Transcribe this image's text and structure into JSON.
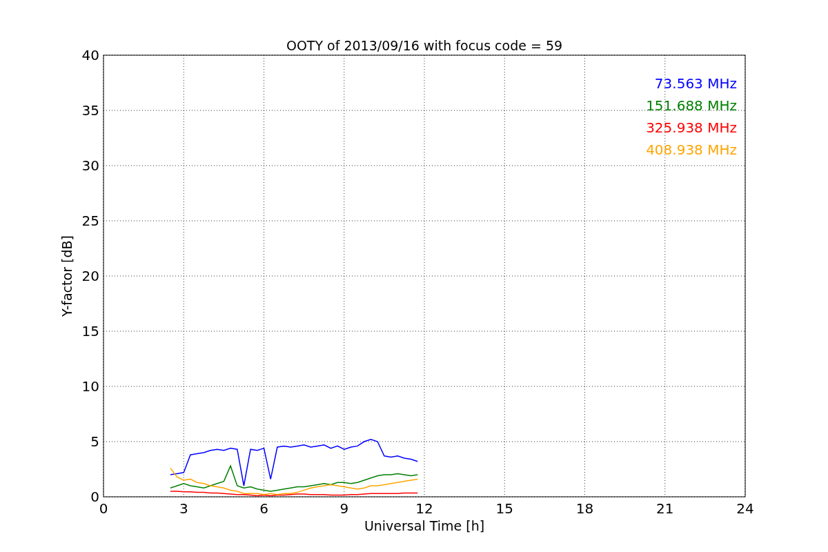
{
  "chart_data": {
    "type": "line",
    "title": "OOTY of 2013/09/16 with focus code = 59",
    "xlabel": "Universal Time [h]",
    "ylabel": "Y-factor [dB]",
    "xlim": [
      0,
      24
    ],
    "ylim": [
      0,
      40
    ],
    "xticks": [
      0,
      3,
      6,
      9,
      12,
      15,
      18,
      21,
      24
    ],
    "yticks": [
      0,
      5,
      10,
      15,
      20,
      25,
      30,
      35,
      40
    ],
    "grid": true,
    "x": [
      2.5,
      2.75,
      3.0,
      3.25,
      3.5,
      3.75,
      4.0,
      4.25,
      4.5,
      4.75,
      5.0,
      5.25,
      5.5,
      5.75,
      6.0,
      6.25,
      6.5,
      6.75,
      7.0,
      7.25,
      7.5,
      7.75,
      8.0,
      8.25,
      8.5,
      8.75,
      9.0,
      9.25,
      9.5,
      9.75,
      10.0,
      10.25,
      10.5,
      10.75,
      11.0,
      11.25,
      11.5,
      11.75
    ],
    "series": [
      {
        "name": "73.563 MHz",
        "color": "#0000ff",
        "values": [
          2.0,
          2.1,
          2.2,
          3.8,
          3.9,
          4.0,
          4.2,
          4.3,
          4.2,
          4.4,
          4.3,
          1.0,
          4.3,
          4.2,
          4.4,
          1.6,
          4.5,
          4.6,
          4.5,
          4.6,
          4.7,
          4.5,
          4.6,
          4.7,
          4.4,
          4.6,
          4.3,
          4.5,
          4.6,
          5.0,
          5.2,
          5.0,
          3.7,
          3.6,
          3.7,
          3.5,
          3.4,
          3.2
        ]
      },
      {
        "name": "151.688 MHz",
        "color": "#008000",
        "values": [
          0.8,
          1.0,
          1.2,
          1.0,
          0.9,
          0.8,
          1.0,
          1.2,
          1.4,
          2.8,
          1.0,
          0.8,
          0.9,
          0.7,
          0.6,
          0.5,
          0.6,
          0.7,
          0.8,
          0.9,
          0.9,
          1.0,
          1.1,
          1.2,
          1.1,
          1.3,
          1.3,
          1.2,
          1.3,
          1.5,
          1.7,
          1.9,
          2.0,
          2.0,
          2.1,
          2.0,
          1.9,
          2.0
        ]
      },
      {
        "name": "325.938 MHz",
        "color": "#ff0000",
        "values": [
          0.5,
          0.5,
          0.45,
          0.45,
          0.4,
          0.4,
          0.35,
          0.35,
          0.3,
          0.25,
          0.2,
          0.2,
          0.15,
          0.1,
          0.15,
          0.1,
          0.15,
          0.15,
          0.2,
          0.25,
          0.25,
          0.2,
          0.2,
          0.2,
          0.15,
          0.15,
          0.15,
          0.2,
          0.2,
          0.25,
          0.3,
          0.3,
          0.3,
          0.3,
          0.3,
          0.35,
          0.35,
          0.35
        ]
      },
      {
        "name": "408.938 MHz",
        "color": "#ffa500",
        "values": [
          2.6,
          1.8,
          1.5,
          1.6,
          1.3,
          1.2,
          1.0,
          0.9,
          0.8,
          0.6,
          0.5,
          0.3,
          0.3,
          0.3,
          0.2,
          0.3,
          0.2,
          0.3,
          0.3,
          0.4,
          0.6,
          0.8,
          0.9,
          1.0,
          1.1,
          1.0,
          0.9,
          0.8,
          0.7,
          0.8,
          1.0,
          1.0,
          1.1,
          1.2,
          1.3,
          1.4,
          1.5,
          1.6
        ]
      }
    ]
  }
}
